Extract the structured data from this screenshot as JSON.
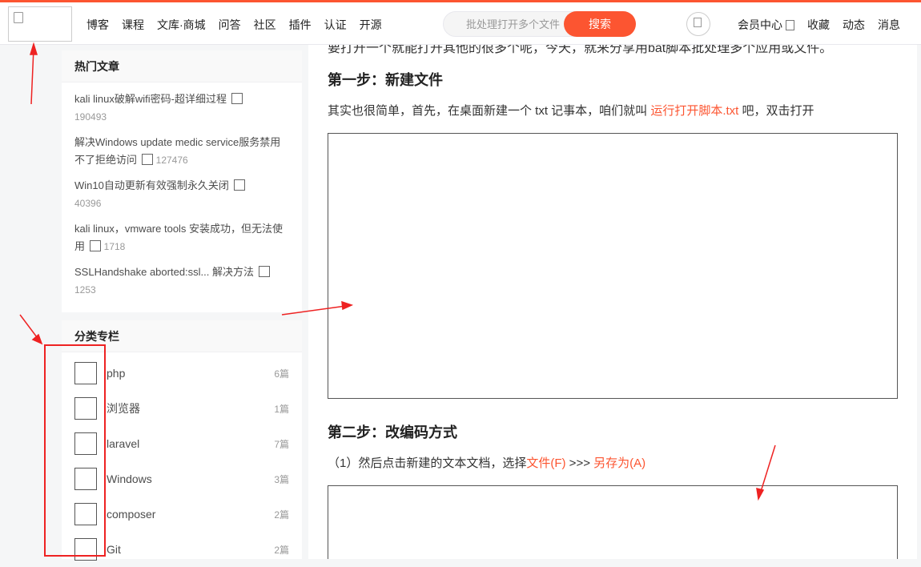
{
  "topbar": {
    "nav_items": [
      "博客",
      "课程",
      "文库·商城",
      "问答",
      "社区",
      "插件",
      "认证",
      "开源"
    ],
    "search_placeholder": "批处理打开多个文件",
    "search_button": "搜索",
    "right_items": [
      "会员中心",
      "收藏",
      "动态",
      "消息"
    ]
  },
  "sidebar": {
    "hot_title": "热门文章",
    "hot_articles": [
      {
        "title": "kali linux破解wifi密码-超详细过程",
        "count": "190493"
      },
      {
        "title": "解决Windows update medic service服务禁用不了拒绝访问",
        "count": "127476"
      },
      {
        "title": "Win10自动更新有效强制永久关闭",
        "count": "40396"
      },
      {
        "title": "kali linux，vmware tools 安装成功，但无法使用",
        "count": "1718"
      },
      {
        "title": "SSLHandshake aborted:ssl... 解决方法",
        "count": "1253"
      }
    ],
    "cat_title": "分类专栏",
    "categories": [
      {
        "name": "php",
        "count": "6篇"
      },
      {
        "name": "浏览器",
        "count": "1篇"
      },
      {
        "name": "laravel",
        "count": "7篇"
      },
      {
        "name": "Windows",
        "count": "3篇"
      },
      {
        "name": "composer",
        "count": "2篇"
      },
      {
        "name": "Git",
        "count": "2篇"
      }
    ]
  },
  "article": {
    "clipped_top": "要打开一个就能打开其他的很多个呢，今天，就来分享用bat脚本批处理多个应用或文件。",
    "step1_heading": "第一步：新建文件",
    "step1_text_a": "其实也很简单，首先，在桌面新建一个 txt 记事本，咱们就叫 ",
    "step1_link": "运行打开脚本.txt",
    "step1_text_b": " 吧，双击打开",
    "step2_heading": "第二步：改编码方式",
    "step2_text_a": "（1）然后点击新建的文本文档，选择",
    "step2_link1": "文件(F)",
    "step2_text_b": " >>> ",
    "step2_link2": "另存为(A)"
  },
  "colors": {
    "accent": "#fc5531",
    "annotation": "#e22222"
  }
}
